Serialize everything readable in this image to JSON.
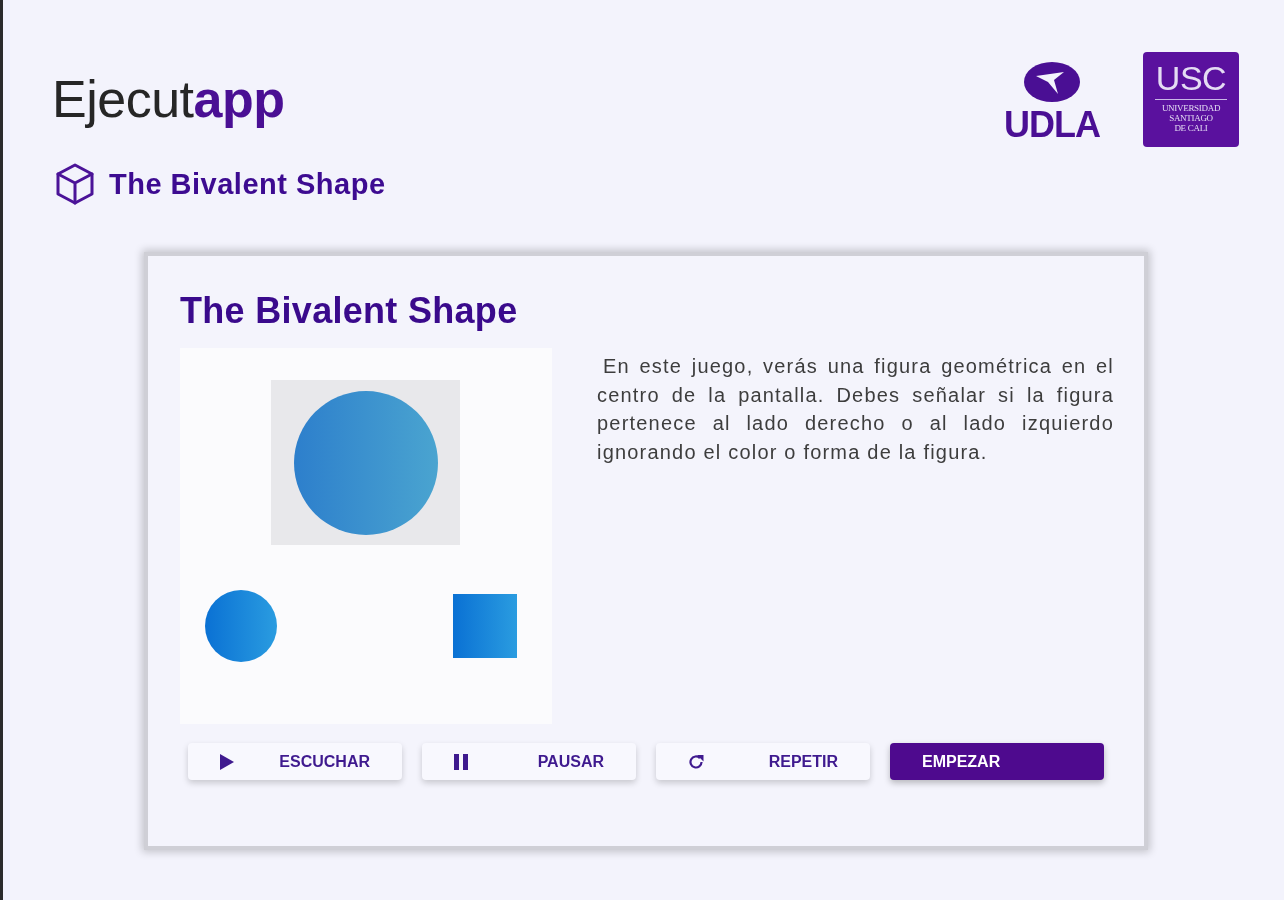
{
  "header": {
    "logo": "Ejecut**app**",
    "partner_logos": [
      {
        "kind": "udla",
        "text": "UDLA"
      },
      {
        "kind": "usc",
        "title": "USC",
        "lines": [
          "UNIVERSIDAD",
          "SANTIAGO",
          "DE CALI"
        ]
      }
    ]
  },
  "breadcrumb": {
    "title": "The Bivalent Shape"
  },
  "card": {
    "title": "The Bivalent Shape",
    "description": "En este juego, verás una figura geométrica en el centro de la pantalla. Debes señalar si la figura pertenece al lado derecho o al lado izquierdo ignorando el color o forma de la figura.",
    "buttons": [
      {
        "kind": "play",
        "label": "ESCUCHAR"
      },
      {
        "kind": "pause",
        "label": "PAUSAR"
      },
      {
        "kind": "repeat",
        "label": "REPETIR"
      },
      {
        "kind": "start",
        "label": "EMPEZAR"
      }
    ]
  }
}
